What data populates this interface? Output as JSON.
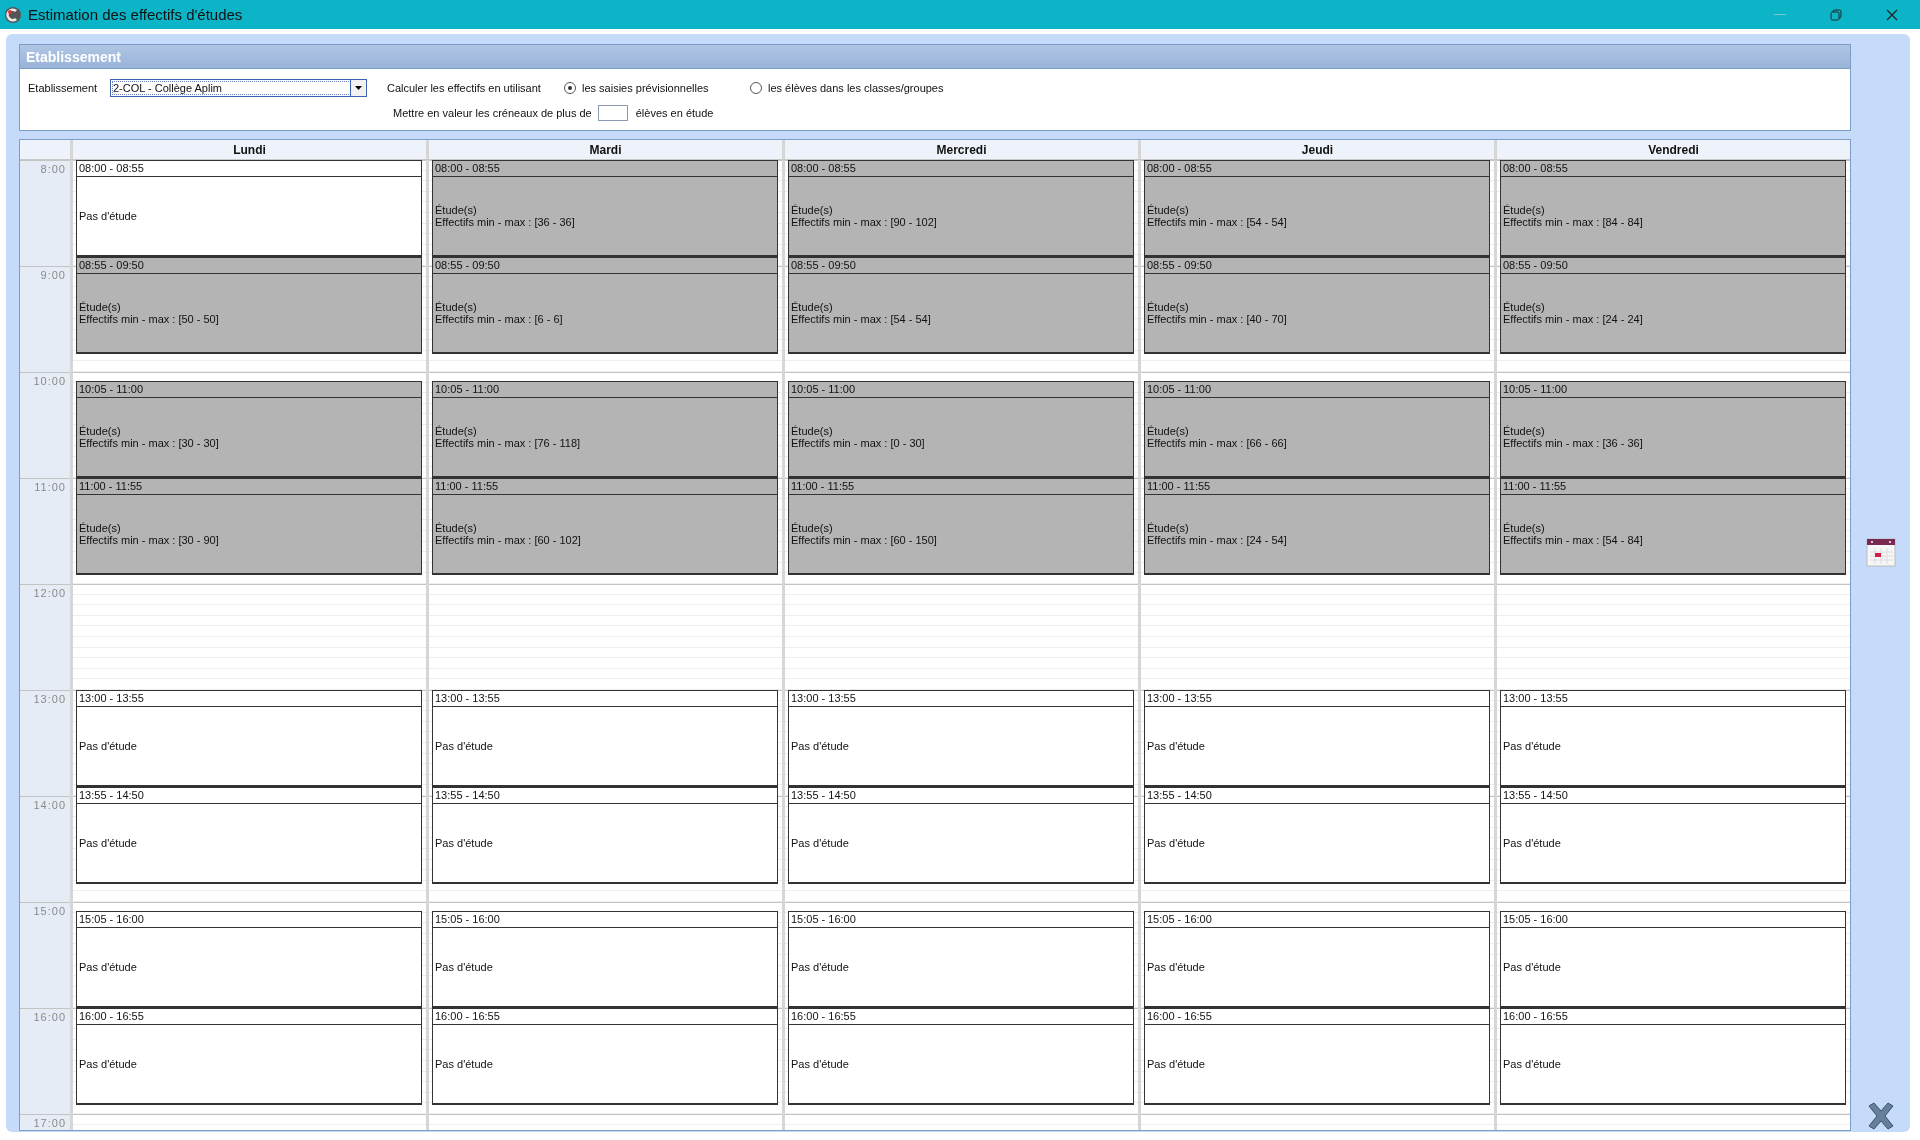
{
  "window": {
    "title": "Estimation des effectifs d'études"
  },
  "panel": {
    "title": "Etablissement",
    "field_label": "Etablissement",
    "select_value": "2-COL - Collège Aplim",
    "calc_label": "Calculer les effectifs en utilisant",
    "options": [
      {
        "label": "les saisies prévisionnelles",
        "selected": true
      },
      {
        "label": "les élèves dans les classes/groupes",
        "selected": false
      }
    ],
    "highlight_before": "Mettre en valeur les créneaux de plus de",
    "highlight_after": "élèves en étude"
  },
  "hours": [
    "8:00",
    "9:00",
    "10:00",
    "11:00",
    "12:00",
    "13:00",
    "14:00",
    "15:00",
    "16:00",
    "17:00"
  ],
  "days": [
    {
      "name": "Lundi",
      "slots": [
        {
          "time": "08:00 - 08:55",
          "kind": "free",
          "status": "Pas d'étude"
        },
        {
          "time": "08:55 - 09:50",
          "kind": "study",
          "status": "Étude(s)",
          "range": "Effectifs min - max : [50 - 50]"
        },
        {
          "time": "10:05 - 11:00",
          "kind": "study",
          "status": "Étude(s)",
          "range": "Effectifs min - max : [30 - 30]"
        },
        {
          "time": "11:00 - 11:55",
          "kind": "study",
          "status": "Étude(s)",
          "range": "Effectifs min - max : [30 - 90]"
        },
        {
          "time": "13:00 - 13:55",
          "kind": "free",
          "status": "Pas d'étude"
        },
        {
          "time": "13:55 - 14:50",
          "kind": "free",
          "status": "Pas d'étude"
        },
        {
          "time": "15:05 - 16:00",
          "kind": "free",
          "status": "Pas d'étude"
        },
        {
          "time": "16:00 - 16:55",
          "kind": "free",
          "status": "Pas d'étude"
        }
      ]
    },
    {
      "name": "Mardi",
      "slots": [
        {
          "time": "08:00 - 08:55",
          "kind": "study",
          "status": "Étude(s)",
          "range": "Effectifs min - max : [36 - 36]"
        },
        {
          "time": "08:55 - 09:50",
          "kind": "study",
          "status": "Étude(s)",
          "range": "Effectifs min - max : [6 - 6]"
        },
        {
          "time": "10:05 - 11:00",
          "kind": "study",
          "status": "Étude(s)",
          "range": "Effectifs min - max : [76 - 118]"
        },
        {
          "time": "11:00 - 11:55",
          "kind": "study",
          "status": "Étude(s)",
          "range": "Effectifs min - max : [60 - 102]"
        },
        {
          "time": "13:00 - 13:55",
          "kind": "free",
          "status": "Pas d'étude"
        },
        {
          "time": "13:55 - 14:50",
          "kind": "free",
          "status": "Pas d'étude"
        },
        {
          "time": "15:05 - 16:00",
          "kind": "free",
          "status": "Pas d'étude"
        },
        {
          "time": "16:00 - 16:55",
          "kind": "free",
          "status": "Pas d'étude"
        }
      ]
    },
    {
      "name": "Mercredi",
      "slots": [
        {
          "time": "08:00 - 08:55",
          "kind": "study",
          "status": "Étude(s)",
          "range": "Effectifs min - max : [90 - 102]"
        },
        {
          "time": "08:55 - 09:50",
          "kind": "study",
          "status": "Étude(s)",
          "range": "Effectifs min - max : [54 - 54]"
        },
        {
          "time": "10:05 - 11:00",
          "kind": "study",
          "status": "Étude(s)",
          "range": "Effectifs min - max : [0 - 30]"
        },
        {
          "time": "11:00 - 11:55",
          "kind": "study",
          "status": "Étude(s)",
          "range": "Effectifs min - max : [60 - 150]"
        },
        {
          "time": "13:00 - 13:55",
          "kind": "free",
          "status": "Pas d'étude"
        },
        {
          "time": "13:55 - 14:50",
          "kind": "free",
          "status": "Pas d'étude"
        },
        {
          "time": "15:05 - 16:00",
          "kind": "free",
          "status": "Pas d'étude"
        },
        {
          "time": "16:00 - 16:55",
          "kind": "free",
          "status": "Pas d'étude"
        }
      ]
    },
    {
      "name": "Jeudi",
      "slots": [
        {
          "time": "08:00 - 08:55",
          "kind": "study",
          "status": "Étude(s)",
          "range": "Effectifs min - max : [54 - 54]"
        },
        {
          "time": "08:55 - 09:50",
          "kind": "study",
          "status": "Étude(s)",
          "range": "Effectifs min - max : [40 - 70]"
        },
        {
          "time": "10:05 - 11:00",
          "kind": "study",
          "status": "Étude(s)",
          "range": "Effectifs min - max : [66 - 66]"
        },
        {
          "time": "11:00 - 11:55",
          "kind": "study",
          "status": "Étude(s)",
          "range": "Effectifs min - max : [24 - 54]"
        },
        {
          "time": "13:00 - 13:55",
          "kind": "free",
          "status": "Pas d'étude"
        },
        {
          "time": "13:55 - 14:50",
          "kind": "free",
          "status": "Pas d'étude"
        },
        {
          "time": "15:05 - 16:00",
          "kind": "free",
          "status": "Pas d'étude"
        },
        {
          "time": "16:00 - 16:55",
          "kind": "free",
          "status": "Pas d'étude"
        }
      ]
    },
    {
      "name": "Vendredi",
      "slots": [
        {
          "time": "08:00 - 08:55",
          "kind": "study",
          "status": "Étude(s)",
          "range": "Effectifs min - max : [84 - 84]"
        },
        {
          "time": "08:55 - 09:50",
          "kind": "study",
          "status": "Étude(s)",
          "range": "Effectifs min - max : [24 - 24]"
        },
        {
          "time": "10:05 - 11:00",
          "kind": "study",
          "status": "Étude(s)",
          "range": "Effectifs min - max : [36 - 36]"
        },
        {
          "time": "11:00 - 11:55",
          "kind": "study",
          "status": "Étude(s)",
          "range": "Effectifs min - max : [54 - 84]"
        },
        {
          "time": "13:00 - 13:55",
          "kind": "free",
          "status": "Pas d'étude"
        },
        {
          "time": "13:55 - 14:50",
          "kind": "free",
          "status": "Pas d'étude"
        },
        {
          "time": "15:05 - 16:00",
          "kind": "free",
          "status": "Pas d'étude"
        },
        {
          "time": "16:00 - 16:55",
          "kind": "free",
          "status": "Pas d'étude"
        }
      ]
    }
  ]
}
